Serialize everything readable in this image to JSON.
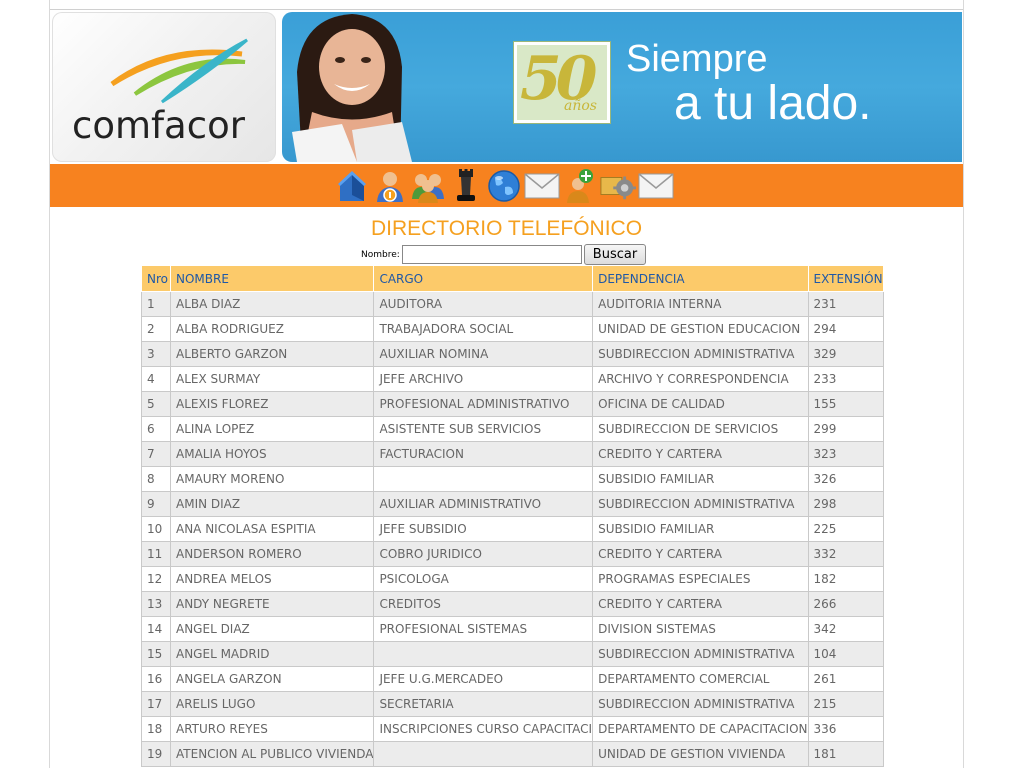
{
  "header": {
    "logo_text": "comfacor",
    "badge_number": "50",
    "badge_years": "años",
    "slogan_line1": "Siempre",
    "slogan_line2": "a tu lado."
  },
  "nav": {
    "icons": [
      "home-icon",
      "user-info-icon",
      "users-group-icon",
      "chess-icon",
      "globe-icon",
      "mail-icon",
      "add-user-icon",
      "settings-icon",
      "mail-icon"
    ]
  },
  "page": {
    "title": "DIRECTORIO TELEFÓNICO"
  },
  "search": {
    "label": "Nombre:",
    "value": "",
    "button": "Buscar"
  },
  "table": {
    "columns": [
      "Nro",
      "NOMBRE",
      "CARGO",
      "DEPENDENCIA",
      "EXTENSIÓN"
    ],
    "rows": [
      [
        "1",
        "ALBA DIAZ",
        "AUDITORA",
        "AUDITORIA INTERNA",
        "231"
      ],
      [
        "2",
        "ALBA RODRIGUEZ",
        "TRABAJADORA SOCIAL",
        "UNIDAD DE GESTION EDUCACION",
        "294"
      ],
      [
        "3",
        "ALBERTO GARZON",
        "AUXILIAR NOMINA",
        "SUBDIRECCION ADMINISTRATIVA",
        "329"
      ],
      [
        "4",
        "ALEX SURMAY",
        "JEFE ARCHIVO",
        "ARCHIVO Y CORRESPONDENCIA",
        "233"
      ],
      [
        "5",
        "ALEXIS FLOREZ",
        "PROFESIONAL ADMINISTRATIVO",
        "OFICINA DE CALIDAD",
        "155"
      ],
      [
        "6",
        "ALINA LOPEZ",
        "ASISTENTE SUB SERVICIOS",
        "SUBDIRECCION DE SERVICIOS",
        "299"
      ],
      [
        "7",
        "AMALIA HOYOS",
        "FACTURACION",
        "CREDITO Y CARTERA",
        "323"
      ],
      [
        "8",
        "AMAURY MORENO",
        "",
        "SUBSIDIO FAMILIAR",
        "326"
      ],
      [
        "9",
        "AMIN DIAZ",
        "AUXILIAR ADMINISTRATIVO",
        "SUBDIRECCION ADMINISTRATIVA",
        "298"
      ],
      [
        "10",
        "ANA NICOLASA ESPITIA",
        "JEFE SUBSIDIO",
        "SUBSIDIO FAMILIAR",
        "225"
      ],
      [
        "11",
        "ANDERSON ROMERO",
        "COBRO JURIDICO",
        "CREDITO Y CARTERA",
        "332"
      ],
      [
        "12",
        "ANDREA MELOS",
        "PSICOLOGA",
        "PROGRAMAS ESPECIALES",
        "182"
      ],
      [
        "13",
        "ANDY NEGRETE",
        "CREDITOS",
        "CREDITO Y CARTERA",
        "266"
      ],
      [
        "14",
        "ANGEL DIAZ",
        "PROFESIONAL SISTEMAS",
        "DIVISION SISTEMAS",
        "342"
      ],
      [
        "15",
        "ANGEL MADRID",
        "",
        "SUBDIRECCION ADMINISTRATIVA",
        "104"
      ],
      [
        "16",
        "ANGELA GARZON",
        "JEFE U.G.MERCADEO",
        "DEPARTAMENTO COMERCIAL",
        "261"
      ],
      [
        "17",
        "ARELIS LUGO",
        "SECRETARIA",
        "SUBDIRECCION ADMINISTRATIVA",
        "215"
      ],
      [
        "18",
        "ARTURO REYES",
        "INSCRIPCIONES CURSO CAPACITACI",
        "DEPARTAMENTO DE CAPACITACION",
        "336"
      ],
      [
        "19",
        "ATENCION AL PUBLICO VIVIENDA",
        "",
        "UNIDAD DE GESTION VIVIENDA",
        "181"
      ]
    ]
  },
  "colors": {
    "nav_bar": "#f7821f",
    "title": "#f5a01f",
    "header_row": "#fcca6a",
    "header_text": "#1f58a6",
    "banner_blue": "#3a9fd7"
  }
}
